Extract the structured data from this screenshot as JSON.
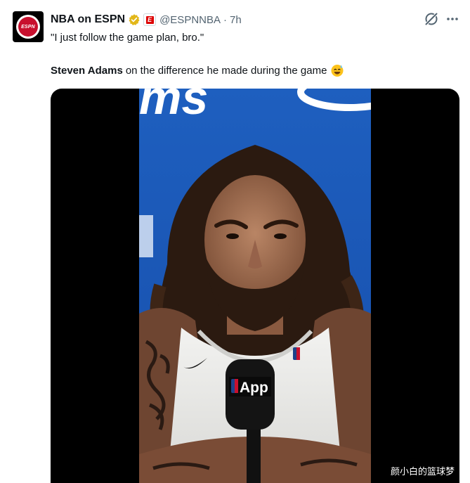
{
  "tweet": {
    "author_name": "NBA on ESPN",
    "handle": "@ESPNNBA",
    "separator": "·",
    "time": "7h",
    "quote": "\"I just follow the game plan, bro.\"",
    "mention": "Steven Adams",
    "caption_rest": "on the difference he made during the game",
    "avatar_text": "ESPN",
    "espn_badge": "E"
  },
  "icons": {
    "verified": "verified-badge-icon",
    "grok": "grok-icon",
    "more": "more-icon",
    "emoji": "sweat-smile-emoji"
  },
  "media": {
    "mic_logo_text": "App",
    "backdrop_text": "ms",
    "watermark": "颜小白的篮球梦"
  },
  "colors": {
    "background": "#ffffff",
    "text_primary": "#0f1419",
    "text_secondary": "#536471",
    "verified_gold": "#e2b719",
    "espn_red": "#d00000",
    "video_blue": "#1e5fbf"
  }
}
